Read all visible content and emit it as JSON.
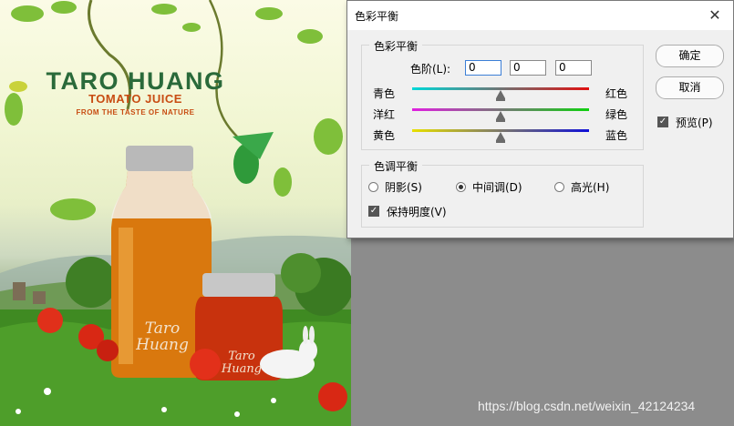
{
  "artwork": {
    "brand_title": "TARO HUANG",
    "brand_subtitle": "TOMATO JUICE",
    "brand_tagline": "FROM THE TASTE OF NATURE",
    "bottle_logo_line1": "Taro",
    "bottle_logo_line2": "Huang",
    "jar_logo_line1": "Taro",
    "jar_logo_line2": "Huang"
  },
  "dialog": {
    "title": "色彩平衡",
    "color_balance": {
      "group_label": "色彩平衡",
      "levels_label": "色阶(L):",
      "levels": [
        "0",
        "0",
        "0"
      ],
      "sliders": [
        {
          "left": "青色",
          "right": "红色",
          "value": 0,
          "track_from": "#00d8d8",
          "track_to": "#e01010"
        },
        {
          "left": "洋红",
          "right": "绿色",
          "value": 0,
          "track_from": "#e020e0",
          "track_to": "#10d010"
        },
        {
          "left": "黄色",
          "right": "蓝色",
          "value": 0,
          "track_from": "#e8e000",
          "track_to": "#1010d8"
        }
      ]
    },
    "tone_balance": {
      "group_label": "色调平衡",
      "options": [
        {
          "label": "阴影(S)",
          "selected": false
        },
        {
          "label": "中间调(D)",
          "selected": true
        },
        {
          "label": "高光(H)",
          "selected": false
        }
      ],
      "preserve_luminosity_label": "保持明度(V)",
      "preserve_luminosity": true
    },
    "ok_label": "确定",
    "cancel_label": "取消",
    "preview_label": "预览(P)",
    "preview": true
  },
  "watermark": "https://blog.csdn.net/weixin_42124234"
}
